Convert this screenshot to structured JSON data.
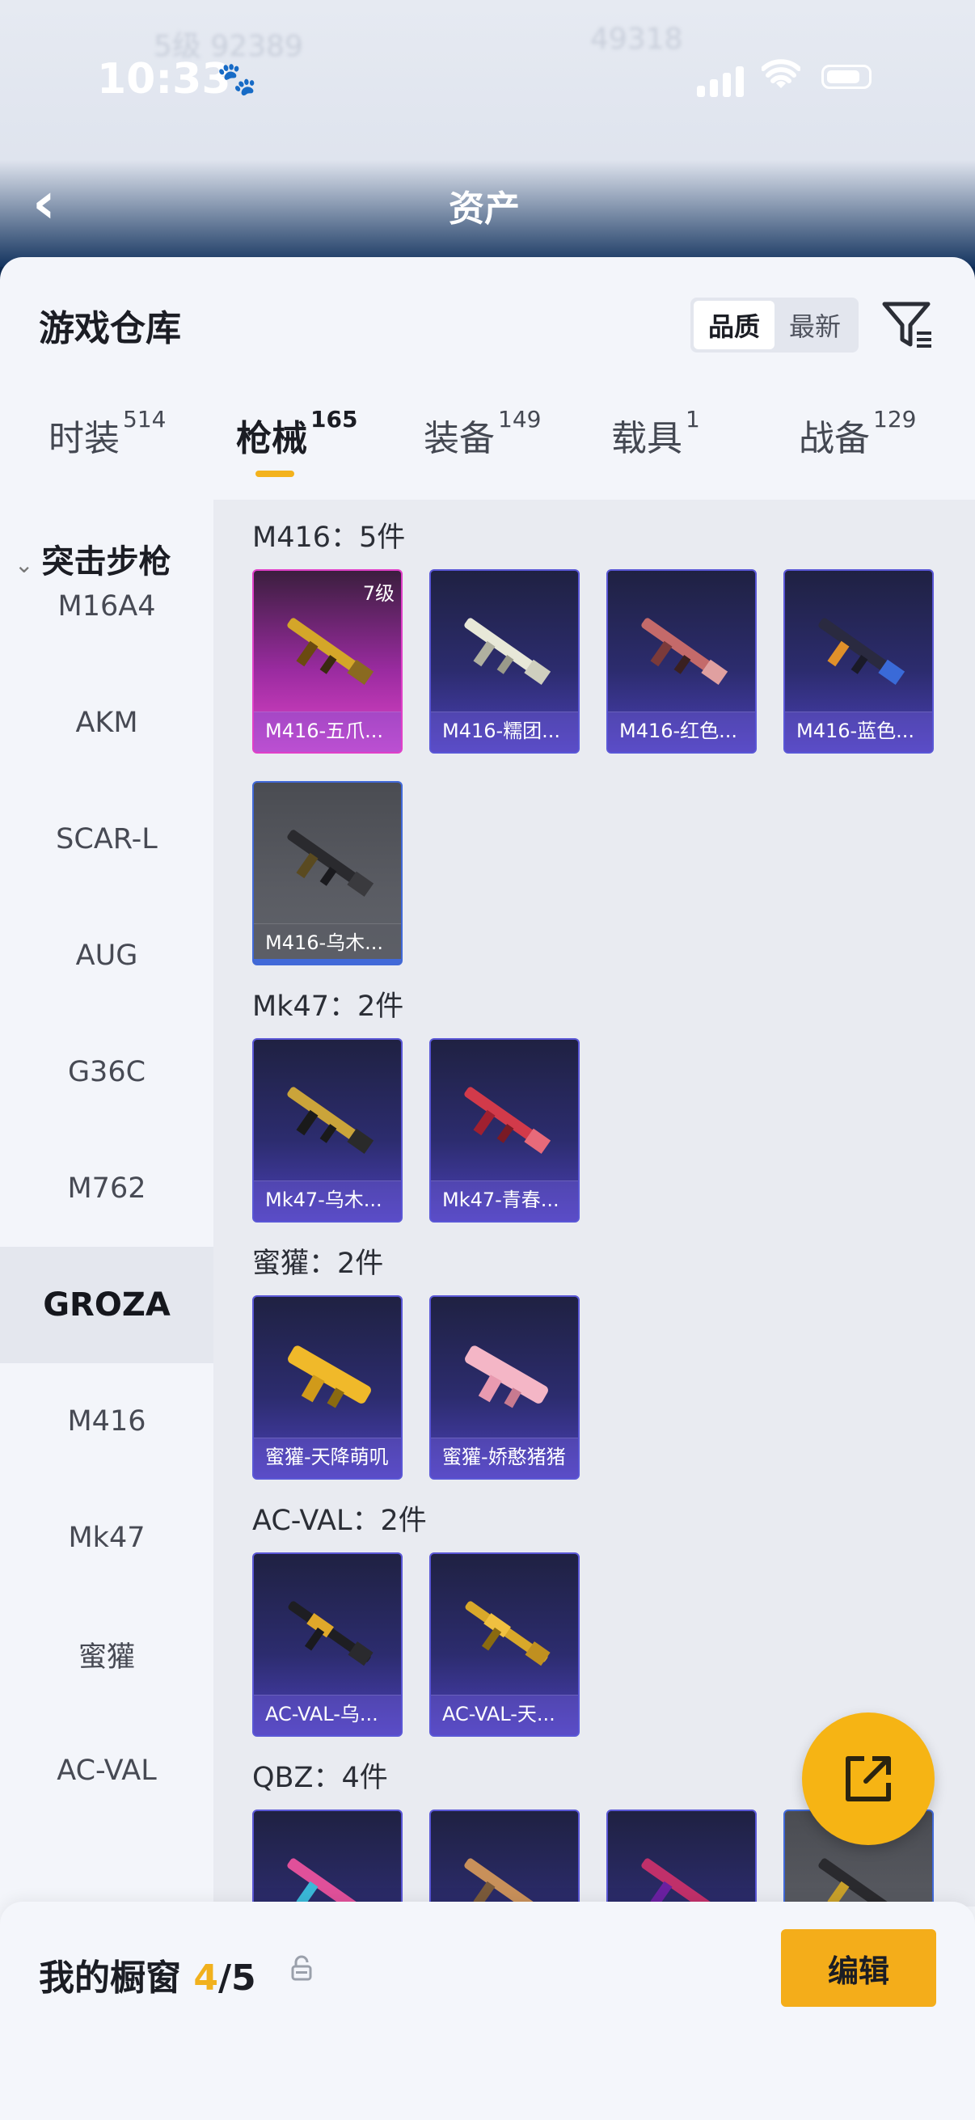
{
  "background": {
    "status_time": "10:33",
    "page_title": "资产",
    "ghost_left": "5级  92389",
    "ghost_right": "49318"
  },
  "sheet": {
    "title": "游戏仓库",
    "sort_options": [
      "品质",
      "最新"
    ],
    "sort_selected": "品质"
  },
  "tabs": [
    {
      "label": "时装",
      "count": "514",
      "active": false
    },
    {
      "label": "枪械",
      "count": "165",
      "active": true
    },
    {
      "label": "装备",
      "count": "149",
      "active": false
    },
    {
      "label": "载具",
      "count": "1",
      "active": false
    },
    {
      "label": "战备",
      "count": "129",
      "active": false
    }
  ],
  "sidebar": {
    "category": "突击步枪",
    "items": [
      "M16A4",
      "AKM",
      "SCAR-L",
      "AUG",
      "G36C",
      "M762",
      "GROZA",
      "M416",
      "Mk47",
      "蜜獾",
      "AC-VAL"
    ],
    "selected": "GROZA"
  },
  "groups": [
    {
      "title": "M416：5件",
      "items": [
        "M416-五爪...",
        "M416-糯团...",
        "M416-红色...",
        "M416-蓝色...",
        "M416-乌木..."
      ],
      "level_badge": "7级"
    },
    {
      "title": "Mk47：2件",
      "items": [
        "Mk47-乌木...",
        "Mk47-青春..."
      ]
    },
    {
      "title": "蜜獾：2件",
      "items": [
        "蜜獾-天降萌叽",
        "蜜獾-娇憨猪猪"
      ]
    },
    {
      "title": "AC-VAL：2件",
      "items": [
        "AC-VAL-乌...",
        "AC-VAL-天..."
      ]
    },
    {
      "title": "QBZ：4件",
      "items": []
    }
  ],
  "showcase": {
    "label": "我的橱窗",
    "current": "4",
    "total": "/5",
    "edit_label": "编辑"
  },
  "colors": {
    "accent": "#f4ad1a",
    "tab_indicator": "#f3b21c",
    "card_purple": "#2c2c6e",
    "card_pink": "#e045c8",
    "card_grey": "#5a5c63"
  },
  "icons": [
    "back-arrow-icon",
    "paw-icon",
    "signal-icon",
    "wifi-icon",
    "battery-icon",
    "filter-icon",
    "chevron-down-icon",
    "lock-icon",
    "share-icon"
  ]
}
